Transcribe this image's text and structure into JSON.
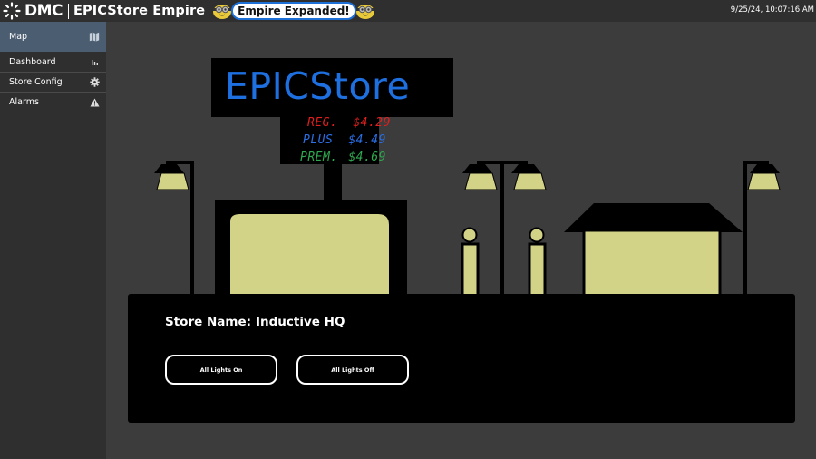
{
  "header": {
    "logo_text": "DMC",
    "app_title": "EPICStore Empire",
    "banner_text": "Empire Expanded!",
    "timestamp": "9/25/24, 10:07:16 AM"
  },
  "sidebar": {
    "items": [
      {
        "label": "Map",
        "icon": "map-icon",
        "active": true
      },
      {
        "label": "Dashboard",
        "icon": "bar-chart-icon",
        "active": false
      },
      {
        "label": "Store Config",
        "icon": "gear-icon",
        "active": false
      },
      {
        "label": "Alarms",
        "icon": "warning-icon",
        "active": false
      }
    ]
  },
  "scene": {
    "sign_title": "EPICStore",
    "prices": [
      {
        "label": "REG.",
        "value": "$4.29",
        "color": "#e01f1f"
      },
      {
        "label": "PLUS",
        "value": "$4.49",
        "color": "#2a6fe6"
      },
      {
        "label": "PREM.",
        "value": "$4.69",
        "color": "#2fa84f"
      }
    ],
    "light_color": "#d3d388"
  },
  "panel": {
    "store_name_label": "Store Name:",
    "store_name_value": "Inductive HQ",
    "buttons": {
      "lights_on": "All Lights On",
      "lights_off": "All Lights Off"
    }
  }
}
